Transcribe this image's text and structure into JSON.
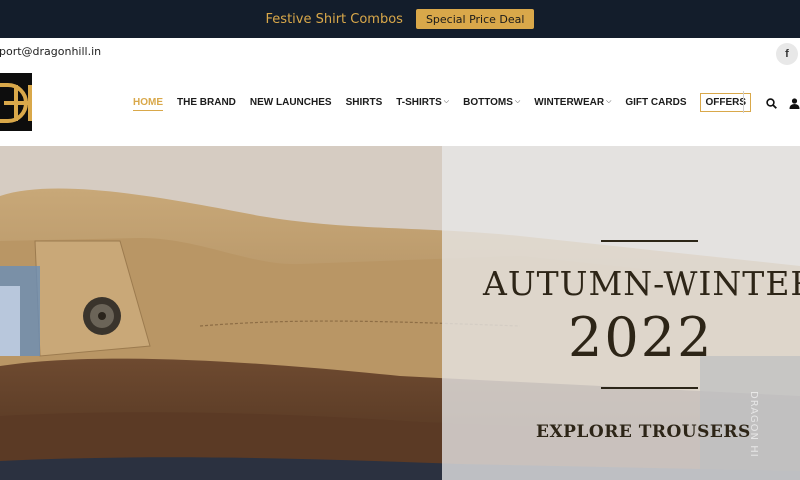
{
  "announcement": {
    "text": "Festive Shirt Combos",
    "button_label": "Special Price Deal",
    "bg_color": "#131d2b",
    "accent_color": "#d9a84a"
  },
  "contact": {
    "email": "pport@dragonhill.in"
  },
  "social": {
    "facebook_glyph": "f"
  },
  "nav": {
    "items": [
      {
        "label": "HOME",
        "active": true,
        "has_dropdown": false
      },
      {
        "label": "THE BRAND",
        "has_dropdown": false
      },
      {
        "label": "NEW LAUNCHES",
        "has_dropdown": false
      },
      {
        "label": "SHIRTS",
        "has_dropdown": false
      },
      {
        "label": "T-SHIRTS",
        "has_dropdown": true
      },
      {
        "label": "BOTTOMS",
        "has_dropdown": true
      },
      {
        "label": "WINTERWEAR",
        "has_dropdown": true
      },
      {
        "label": "GIFT CARDS",
        "has_dropdown": false
      },
      {
        "label": "OFFERS",
        "has_dropdown": false
      }
    ],
    "caret_glyph": "⌵"
  },
  "icons": [
    "search-icon",
    "user-icon",
    "facebook-icon",
    "logo-icon"
  ],
  "hero": {
    "title": "AUTUMN-WINTER",
    "year": "2022",
    "cta": "EXPLORE TROUSERS",
    "brand_vertical": "DRAGON HI"
  }
}
